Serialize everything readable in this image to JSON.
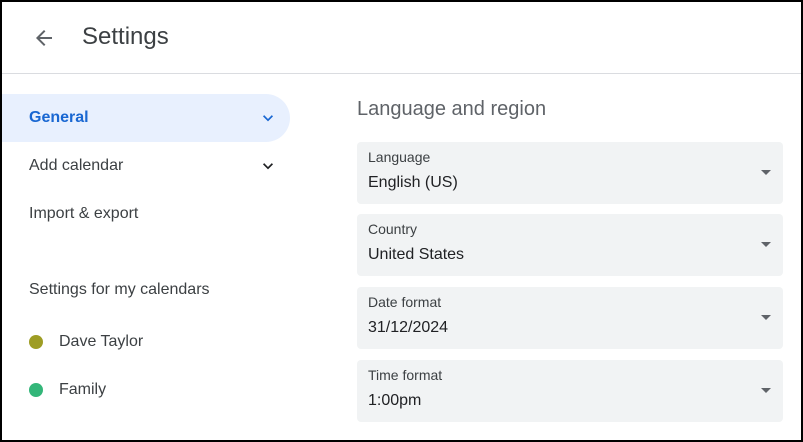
{
  "header": {
    "title": "Settings",
    "back_icon": "arrow-left-icon"
  },
  "sidebar": {
    "items": [
      {
        "label": "General",
        "active": true,
        "chevron": "chevron-down-icon"
      },
      {
        "label": "Add calendar",
        "active": false,
        "chevron": "chevron-down-icon"
      },
      {
        "label": "Import & export",
        "active": false
      }
    ],
    "section_title": "Settings for my calendars",
    "calendars": [
      {
        "name": "Dave Taylor",
        "color": "#9e9d24"
      },
      {
        "name": "Family",
        "color": "#33b679"
      }
    ]
  },
  "main": {
    "section_title": "Language and region",
    "fields": [
      {
        "label": "Language",
        "value": "English (US)"
      },
      {
        "label": "Country",
        "value": "United States"
      },
      {
        "label": "Date format",
        "value": "31/12/2024"
      },
      {
        "label": "Time format",
        "value": "1:00pm"
      }
    ]
  },
  "colors": {
    "accent": "#1967d2",
    "active_bg": "#e8f0fe",
    "field_bg": "#f1f3f4"
  }
}
